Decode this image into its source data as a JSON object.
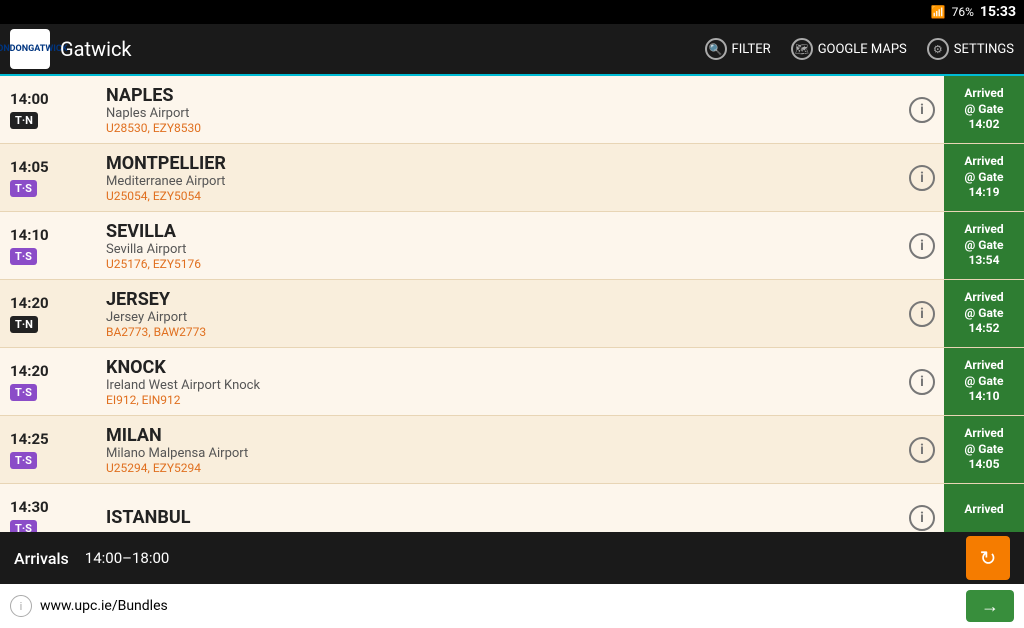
{
  "statusBar": {
    "wifi": "wifi",
    "battery": "76%",
    "time": "15:33"
  },
  "topBar": {
    "appName": "Gatwick",
    "appIconLine1": "LONDON",
    "appIconLine2": "GATWICK",
    "filterLabel": "FILTER",
    "mapsLabel": "GOOGLE MAPS",
    "settingsLabel": "SETTINGS"
  },
  "flights": [
    {
      "time": "14:00",
      "badge": "T·N",
      "badgeType": "tn",
      "destination": "NAPLES",
      "airport": "Naples Airport",
      "codes": "U28530, EZY8530",
      "statusLine1": "Arrived",
      "statusLine2": "@ Gate",
      "statusLine3": "14:02"
    },
    {
      "time": "14:05",
      "badge": "T·S",
      "badgeType": "ts",
      "destination": "MONTPELLIER",
      "airport": "Mediterranee Airport",
      "codes": "U25054, EZY5054",
      "statusLine1": "Arrived",
      "statusLine2": "@ Gate",
      "statusLine3": "14:19"
    },
    {
      "time": "14:10",
      "badge": "T·S",
      "badgeType": "ts",
      "destination": "SEVILLA",
      "airport": "Sevilla Airport",
      "codes": "U25176, EZY5176",
      "statusLine1": "Arrived",
      "statusLine2": "@ Gate",
      "statusLine3": "13:54"
    },
    {
      "time": "14:20",
      "badge": "T·N",
      "badgeType": "tn",
      "destination": "JERSEY",
      "airport": "Jersey Airport",
      "codes": "BA2773, BAW2773",
      "statusLine1": "Arrived",
      "statusLine2": "@ Gate",
      "statusLine3": "14:52"
    },
    {
      "time": "14:20",
      "badge": "T·S",
      "badgeType": "ts",
      "destination": "KNOCK",
      "airport": "Ireland West Airport Knock",
      "codes": "EI912, EIN912",
      "statusLine1": "Arrived",
      "statusLine2": "@ Gate",
      "statusLine3": "14:10"
    },
    {
      "time": "14:25",
      "badge": "T·S",
      "badgeType": "ts",
      "destination": "MILAN",
      "airport": "Milano Malpensa Airport",
      "codes": "U25294, EZY5294",
      "statusLine1": "Arrived",
      "statusLine2": "@ Gate",
      "statusLine3": "14:05"
    },
    {
      "time": "14:30",
      "badge": "T·S",
      "badgeType": "ts",
      "destination": "ISTANBUL",
      "airport": "",
      "codes": "",
      "statusLine1": "Arrived",
      "statusLine2": "",
      "statusLine3": ""
    }
  ],
  "bottomBar": {
    "arrivalsLabel": "Arrivals",
    "timeRange": "14:00–18:00"
  },
  "adBar": {
    "url": "www.upc.ie/Bundles",
    "goArrow": "→"
  }
}
